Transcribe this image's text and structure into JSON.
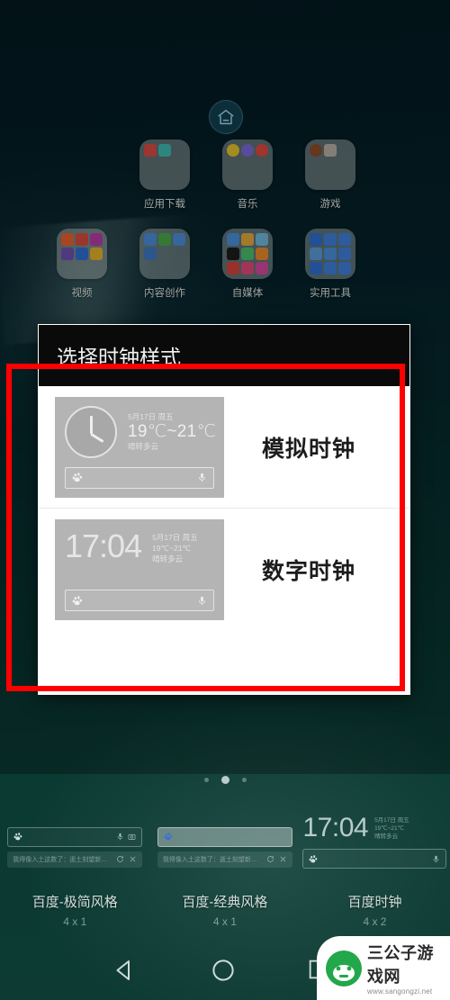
{
  "wallpaper": {
    "bg_color": "#041c23",
    "accent_color": "#0d3b33"
  },
  "homescreen": {
    "home_badge_icon": "home-icon",
    "folders": [
      {
        "label": "应用下载",
        "tiles": [
          "#d94b44",
          "#3fb9b0"
        ]
      },
      {
        "label": "音乐",
        "tiles": [
          "#e3c32c",
          "#7a6ad6",
          "#e0483e"
        ]
      },
      {
        "label": "游戏",
        "tiles": [
          "#8d4d2b",
          "#b8b0a4"
        ]
      },
      {
        "label": "视频",
        "tiles": [
          "#e8622f",
          "#d64b3e",
          "#b43ea8",
          "#6e4fb0",
          "#2f6fd0",
          "#e4b02c"
        ]
      },
      {
        "label": "内容创作",
        "tiles": [
          "#4a8ed8",
          "#4aa84a",
          "#4a8ed8",
          "#3f78c4"
        ]
      },
      {
        "label": "自媒体",
        "tiles": [
          "#4a8ed8",
          "#e0a93c",
          "#6fb8d8",
          "#1c1c1c",
          "#4dbd6e",
          "#e88a2c",
          "#d6433c",
          "#e04a7a",
          "#d14a9e"
        ]
      },
      {
        "label": "实用工具",
        "tiles": [
          "#2f6fd0",
          "#3f7fd8",
          "#3f7fd8",
          "#5a9ad8",
          "#4a8ed8",
          "#3f7fd8",
          "#2f6fd0",
          "#3f7fd8",
          "#3f7fd8"
        ]
      }
    ]
  },
  "carousel": {
    "page_dots": 3,
    "active_dot_index": 1,
    "widgets": [
      {
        "name": "百度-极简风格",
        "size": "4 x 1",
        "style": "plain",
        "search_placeholder": "",
        "suggestion": "我得像入土这数了：逝土刻望新范拟…",
        "icons": [
          "baidu-paw-icon",
          "mic-icon",
          "camera-icon",
          "refresh-icon",
          "close-icon"
        ]
      },
      {
        "name": "百度-经典风格",
        "size": "4 x 1",
        "style": "filled",
        "search_placeholder": "",
        "suggestion": "我得像入土这数了：逝土刻望新范拟…",
        "icons": [
          "baidu-paw-icon",
          "mic-icon",
          "camera-icon",
          "refresh-icon",
          "close-icon"
        ]
      },
      {
        "name": "百度时钟",
        "size": "4 x 2",
        "style": "clock",
        "time": "17:04",
        "weather_date": "5月17日 周五",
        "weather_temp": "19℃~21℃",
        "weather_desc": "晴转多云",
        "icons": [
          "baidu-paw-icon",
          "mic-icon"
        ]
      }
    ]
  },
  "dialog": {
    "title": "选择时钟样式",
    "options": [
      {
        "label": "模拟时钟",
        "preview_type": "analog",
        "weather_date": "5月17日 周五",
        "weather_temp": "19℃~21℃",
        "weather_desc": "晴转多云",
        "icons": [
          "analog-clock-icon",
          "baidu-paw-icon",
          "mic-icon"
        ]
      },
      {
        "label": "数字时钟",
        "preview_type": "digital",
        "time": "17:04",
        "weather_date": "5月17日 周五",
        "weather_temp": "19℃~21℃",
        "weather_desc": "晴转多云",
        "icons": [
          "baidu-paw-icon",
          "mic-icon"
        ]
      }
    ]
  },
  "annotation": {
    "color": "#ff0000",
    "shape": "rectangle"
  },
  "navbar": {
    "back_icon": "back-triangle-icon",
    "home_icon": "home-circle-icon",
    "recent_icon": "recent-square-icon"
  },
  "watermark": {
    "title": "三公子游戏网",
    "url": "www.sangongzi.net",
    "logo_color": "#22a74a"
  }
}
